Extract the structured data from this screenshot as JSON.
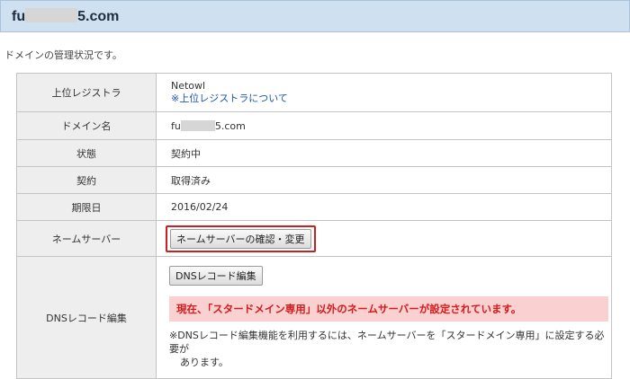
{
  "header": {
    "title_prefix": "fu",
    "title_suffix": "5.com"
  },
  "intro_text": "ドメインの管理状況です。",
  "rows": {
    "registrar": {
      "label": "上位レジストラ",
      "name": "Netowl",
      "link": "※上位レジストラについて"
    },
    "domain": {
      "label": "ドメイン名",
      "prefix": "fu",
      "suffix": "5.com"
    },
    "status": {
      "label": "状態",
      "value": "契約中"
    },
    "contract": {
      "label": "契約",
      "value": "取得済み"
    },
    "expiry": {
      "label": "期限日",
      "value": "2016/02/24"
    },
    "nameserver": {
      "label": "ネームサーバー",
      "button": "ネームサーバーの確認・変更"
    },
    "dns": {
      "label": "DNSレコード編集",
      "button": "DNSレコード編集",
      "alert": "現在、「スタードメイン専用」以外のネームサーバーが設定されています。",
      "note_line1": "※DNSレコード編集機能を利用するには、ネームサーバーを「スタードメイン専用」に設定する必要が",
      "note_line2": "あります。"
    }
  },
  "colors": {
    "header_bg": "#cfe0f1",
    "link": "#1a58b0",
    "alert_bg": "#fbd0d0",
    "alert_text": "#d41a1a",
    "highlight_border": "#cc1f1f"
  }
}
